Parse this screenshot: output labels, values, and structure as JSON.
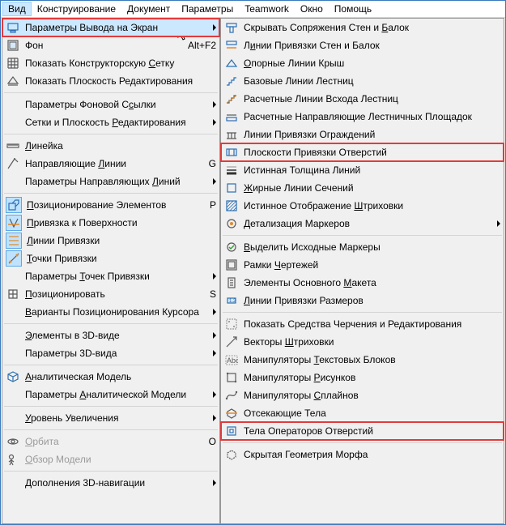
{
  "menubar": {
    "items": [
      "Вид",
      "Конструирование",
      "Документ",
      "Параметры",
      "Teamwork",
      "Окно",
      "Помощь"
    ],
    "active_index": 0
  },
  "panelA": {
    "items": [
      {
        "icon": "screen-output",
        "label": "Параметры Вывода на Экран",
        "submenu": true,
        "highlight": true,
        "hover": true
      },
      {
        "icon": "background",
        "label": "Фон",
        "accel": "‎⌥",
        "shortcut": "Alt+F2"
      },
      {
        "icon": "grid",
        "label": "Показать Конструкторскую Сетку",
        "accel": "С"
      },
      {
        "icon": "edit-plane",
        "label": "Показать Плоскость Редактирования"
      },
      {
        "sep": true
      },
      {
        "icon": "none",
        "label": "Параметры Фоновой Ссылки",
        "accel": "с",
        "submenu": true
      },
      {
        "icon": "none",
        "label": "Сетки и Плоскость Редактирования",
        "accel": "Р",
        "submenu": true
      },
      {
        "sep": true
      },
      {
        "icon": "ruler",
        "label": "Линейка",
        "accel": "Л"
      },
      {
        "icon": "guide",
        "label": "Направляющие Линии",
        "accel": "Л",
        "shortcut": "G"
      },
      {
        "icon": "none",
        "label": "Параметры Направляющих Линий",
        "accel": "Л",
        "submenu": true
      },
      {
        "sep": true
      },
      {
        "icon": "position",
        "label": "Позиционирование Элементов",
        "accel": "П",
        "shortcut": "P",
        "toggled": true
      },
      {
        "icon": "surface-snap",
        "label": "Привязка к Поверхности",
        "accel": "П",
        "toggled": true
      },
      {
        "icon": "snap-lines",
        "label": "Линии Привязки",
        "accel": "Л",
        "toggled": true
      },
      {
        "icon": "snap-points",
        "label": "Точки Привязки",
        "accel": "Т",
        "toggled": true
      },
      {
        "icon": "none",
        "label": "Параметры Точек Привязки",
        "accel": "Т",
        "submenu": true
      },
      {
        "icon": "pos-grid",
        "label": "Позиционировать",
        "accel": "П",
        "shortcut": "S"
      },
      {
        "icon": "none",
        "label": "Варианты Позиционирования Курсора",
        "accel": "В",
        "submenu": true
      },
      {
        "sep": true
      },
      {
        "icon": "none",
        "label": "Элементы в 3D-виде",
        "accel": "Э",
        "submenu": true
      },
      {
        "icon": "none",
        "label": "Параметры 3D-вида",
        "accel": "З",
        "submenu": true
      },
      {
        "sep": true
      },
      {
        "icon": "anal-model",
        "label": "Аналитическая Модель",
        "accel": "А"
      },
      {
        "icon": "none",
        "label": "Параметры Аналитической Модели",
        "accel": "А",
        "submenu": true
      },
      {
        "sep": true
      },
      {
        "icon": "none",
        "label": "Уровень Увеличения",
        "accel": "У",
        "submenu": true
      },
      {
        "sep": true
      },
      {
        "icon": "orbit",
        "label": "Орбита",
        "accel": "О",
        "shortcut": "O",
        "disabled": true
      },
      {
        "icon": "explore",
        "label": "Обзор Модели",
        "accel": "О",
        "disabled": true
      },
      {
        "sep": true
      },
      {
        "icon": "none",
        "label": "Дополнения 3D-навигации",
        "accel": "Д",
        "submenu": true
      }
    ]
  },
  "panelB": {
    "items": [
      {
        "icon": "wall-beam",
        "label": "Скрывать Сопряжения Стен и Балок",
        "accel": "Б"
      },
      {
        "icon": "wall-snap",
        "label": "Линии Привязки Стен и Балок",
        "accel": "и"
      },
      {
        "icon": "roof",
        "label": "Опорные Линии Крыш",
        "accel": "О"
      },
      {
        "icon": "stair-base",
        "label": "Базовые Линии Лестниц"
      },
      {
        "icon": "stair-calc",
        "label": "Расчетные Линии Всхода Лестниц"
      },
      {
        "icon": "platform",
        "label": "Расчетные Направляющие Лестничных Площадок"
      },
      {
        "icon": "rail",
        "label": "Линии Привязки Ограждений"
      },
      {
        "icon": "opening-plane",
        "label": "Плоскости Привязки Отверстий",
        "highlight": true
      },
      {
        "icon": "true-width",
        "label": "Истинная Толщина Линий"
      },
      {
        "icon": "bold-section",
        "label": "Жирные Линии Сечений",
        "accel": "Ж"
      },
      {
        "icon": "hatch",
        "label": "Истинное Отображение Штриховки",
        "accel": "Ш"
      },
      {
        "icon": "marker-detail",
        "label": "Детализация Маркеров",
        "accel": "Д",
        "submenu": true
      },
      {
        "sep": true
      },
      {
        "icon": "src-markers",
        "label": "Выделить Исходные Маркеры",
        "accel": "В"
      },
      {
        "icon": "drawing-frame",
        "label": "Рамки Чертежей",
        "accel": "Ч"
      },
      {
        "icon": "master-items",
        "label": "Элементы Основного Макета",
        "accel": "М"
      },
      {
        "icon": "dim-snap",
        "label": "Линии Привязки Размеров",
        "accel": "Л"
      },
      {
        "sep": true
      },
      {
        "icon": "draft-aids",
        "label": "Показать Средства Черчения и Редактирования"
      },
      {
        "icon": "hatch-vec",
        "label": "Векторы Штриховки",
        "accel": "Ш"
      },
      {
        "icon": "text-handles",
        "label": "Манипуляторы Текстовых Блоков",
        "accel": "Т"
      },
      {
        "icon": "fig-handles",
        "label": "Манипуляторы Рисунков",
        "accel": "Р"
      },
      {
        "icon": "spline-handles",
        "label": "Манипуляторы Сплайнов",
        "accel": "С"
      },
      {
        "icon": "cut-bodies",
        "label": "Отсекающие Тела"
      },
      {
        "icon": "op-bodies",
        "label": "Тела Операторов Отверстий",
        "highlight": true
      },
      {
        "sep": true
      },
      {
        "icon": "morph",
        "label": "Скрытая Геометрия Морфа"
      }
    ]
  }
}
